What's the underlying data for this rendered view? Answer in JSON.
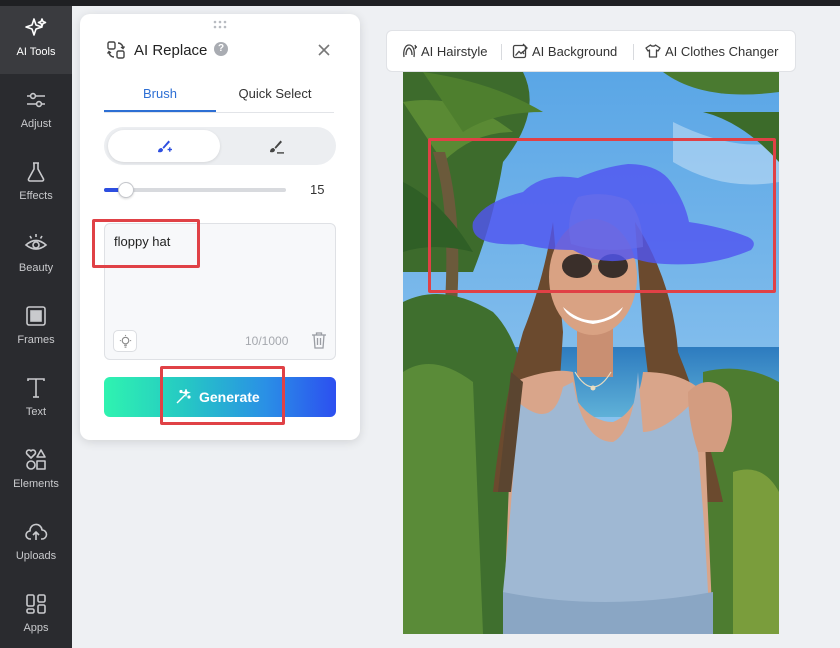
{
  "sidebar": {
    "items": [
      {
        "label": "AI Tools",
        "icon": "sparkle-icon",
        "active": true
      },
      {
        "label": "Adjust",
        "icon": "sliders-icon"
      },
      {
        "label": "Effects",
        "icon": "flask-icon"
      },
      {
        "label": "Beauty",
        "icon": "eye-icon"
      },
      {
        "label": "Frames",
        "icon": "frame-icon"
      },
      {
        "label": "Text",
        "icon": "text-icon"
      },
      {
        "label": "Elements",
        "icon": "shapes-icon"
      },
      {
        "label": "Uploads",
        "icon": "cloud-upload-icon"
      },
      {
        "label": "Apps",
        "icon": "apps-icon"
      }
    ]
  },
  "panel": {
    "title": "AI Replace",
    "help": "?",
    "tabs": [
      {
        "label": "Brush",
        "active": true
      },
      {
        "label": "Quick Select",
        "active": false
      }
    ],
    "modes": [
      "brush-add-icon",
      "brush-erase-icon"
    ],
    "brush_size": {
      "value": "15",
      "min": 0,
      "max": 100,
      "fraction": 0.12
    },
    "prompt": {
      "text": "floppy hat",
      "count": "10/1000"
    },
    "generate_label": "Generate"
  },
  "toolbar": {
    "items": [
      {
        "label": "AI Hairstyle",
        "icon": "hairstyle-icon"
      },
      {
        "label": "AI Background",
        "icon": "background-edit-icon"
      },
      {
        "label": "AI Clothes Changer",
        "icon": "shirt-icon"
      }
    ]
  },
  "colors": {
    "accent": "#2d6fd4",
    "highlight": "#e04146",
    "mask": "#5055f0",
    "rail_bg": "#2a2b2f"
  }
}
